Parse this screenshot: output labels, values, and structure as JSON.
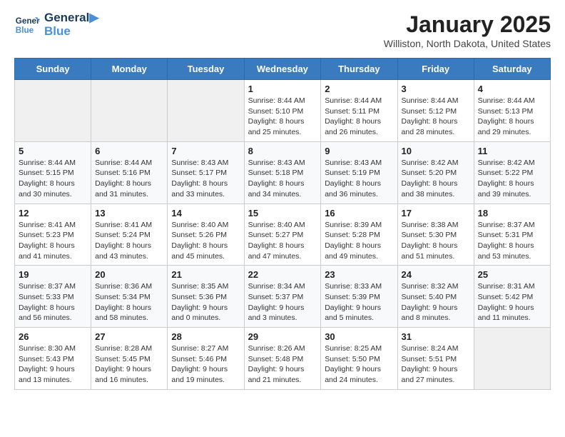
{
  "header": {
    "logo_line1": "General",
    "logo_line2": "Blue",
    "month": "January 2025",
    "location": "Williston, North Dakota, United States"
  },
  "weekdays": [
    "Sunday",
    "Monday",
    "Tuesday",
    "Wednesday",
    "Thursday",
    "Friday",
    "Saturday"
  ],
  "weeks": [
    [
      {
        "day": "",
        "sunrise": "",
        "sunset": "",
        "daylight": ""
      },
      {
        "day": "",
        "sunrise": "",
        "sunset": "",
        "daylight": ""
      },
      {
        "day": "",
        "sunrise": "",
        "sunset": "",
        "daylight": ""
      },
      {
        "day": "1",
        "sunrise": "Sunrise: 8:44 AM",
        "sunset": "Sunset: 5:10 PM",
        "daylight": "Daylight: 8 hours and 25 minutes."
      },
      {
        "day": "2",
        "sunrise": "Sunrise: 8:44 AM",
        "sunset": "Sunset: 5:11 PM",
        "daylight": "Daylight: 8 hours and 26 minutes."
      },
      {
        "day": "3",
        "sunrise": "Sunrise: 8:44 AM",
        "sunset": "Sunset: 5:12 PM",
        "daylight": "Daylight: 8 hours and 28 minutes."
      },
      {
        "day": "4",
        "sunrise": "Sunrise: 8:44 AM",
        "sunset": "Sunset: 5:13 PM",
        "daylight": "Daylight: 8 hours and 29 minutes."
      }
    ],
    [
      {
        "day": "5",
        "sunrise": "Sunrise: 8:44 AM",
        "sunset": "Sunset: 5:15 PM",
        "daylight": "Daylight: 8 hours and 30 minutes."
      },
      {
        "day": "6",
        "sunrise": "Sunrise: 8:44 AM",
        "sunset": "Sunset: 5:16 PM",
        "daylight": "Daylight: 8 hours and 31 minutes."
      },
      {
        "day": "7",
        "sunrise": "Sunrise: 8:43 AM",
        "sunset": "Sunset: 5:17 PM",
        "daylight": "Daylight: 8 hours and 33 minutes."
      },
      {
        "day": "8",
        "sunrise": "Sunrise: 8:43 AM",
        "sunset": "Sunset: 5:18 PM",
        "daylight": "Daylight: 8 hours and 34 minutes."
      },
      {
        "day": "9",
        "sunrise": "Sunrise: 8:43 AM",
        "sunset": "Sunset: 5:19 PM",
        "daylight": "Daylight: 8 hours and 36 minutes."
      },
      {
        "day": "10",
        "sunrise": "Sunrise: 8:42 AM",
        "sunset": "Sunset: 5:20 PM",
        "daylight": "Daylight: 8 hours and 38 minutes."
      },
      {
        "day": "11",
        "sunrise": "Sunrise: 8:42 AM",
        "sunset": "Sunset: 5:22 PM",
        "daylight": "Daylight: 8 hours and 39 minutes."
      }
    ],
    [
      {
        "day": "12",
        "sunrise": "Sunrise: 8:41 AM",
        "sunset": "Sunset: 5:23 PM",
        "daylight": "Daylight: 8 hours and 41 minutes."
      },
      {
        "day": "13",
        "sunrise": "Sunrise: 8:41 AM",
        "sunset": "Sunset: 5:24 PM",
        "daylight": "Daylight: 8 hours and 43 minutes."
      },
      {
        "day": "14",
        "sunrise": "Sunrise: 8:40 AM",
        "sunset": "Sunset: 5:26 PM",
        "daylight": "Daylight: 8 hours and 45 minutes."
      },
      {
        "day": "15",
        "sunrise": "Sunrise: 8:40 AM",
        "sunset": "Sunset: 5:27 PM",
        "daylight": "Daylight: 8 hours and 47 minutes."
      },
      {
        "day": "16",
        "sunrise": "Sunrise: 8:39 AM",
        "sunset": "Sunset: 5:28 PM",
        "daylight": "Daylight: 8 hours and 49 minutes."
      },
      {
        "day": "17",
        "sunrise": "Sunrise: 8:38 AM",
        "sunset": "Sunset: 5:30 PM",
        "daylight": "Daylight: 8 hours and 51 minutes."
      },
      {
        "day": "18",
        "sunrise": "Sunrise: 8:37 AM",
        "sunset": "Sunset: 5:31 PM",
        "daylight": "Daylight: 8 hours and 53 minutes."
      }
    ],
    [
      {
        "day": "19",
        "sunrise": "Sunrise: 8:37 AM",
        "sunset": "Sunset: 5:33 PM",
        "daylight": "Daylight: 8 hours and 56 minutes."
      },
      {
        "day": "20",
        "sunrise": "Sunrise: 8:36 AM",
        "sunset": "Sunset: 5:34 PM",
        "daylight": "Daylight: 8 hours and 58 minutes."
      },
      {
        "day": "21",
        "sunrise": "Sunrise: 8:35 AM",
        "sunset": "Sunset: 5:36 PM",
        "daylight": "Daylight: 9 hours and 0 minutes."
      },
      {
        "day": "22",
        "sunrise": "Sunrise: 8:34 AM",
        "sunset": "Sunset: 5:37 PM",
        "daylight": "Daylight: 9 hours and 3 minutes."
      },
      {
        "day": "23",
        "sunrise": "Sunrise: 8:33 AM",
        "sunset": "Sunset: 5:39 PM",
        "daylight": "Daylight: 9 hours and 5 minutes."
      },
      {
        "day": "24",
        "sunrise": "Sunrise: 8:32 AM",
        "sunset": "Sunset: 5:40 PM",
        "daylight": "Daylight: 9 hours and 8 minutes."
      },
      {
        "day": "25",
        "sunrise": "Sunrise: 8:31 AM",
        "sunset": "Sunset: 5:42 PM",
        "daylight": "Daylight: 9 hours and 11 minutes."
      }
    ],
    [
      {
        "day": "26",
        "sunrise": "Sunrise: 8:30 AM",
        "sunset": "Sunset: 5:43 PM",
        "daylight": "Daylight: 9 hours and 13 minutes."
      },
      {
        "day": "27",
        "sunrise": "Sunrise: 8:28 AM",
        "sunset": "Sunset: 5:45 PM",
        "daylight": "Daylight: 9 hours and 16 minutes."
      },
      {
        "day": "28",
        "sunrise": "Sunrise: 8:27 AM",
        "sunset": "Sunset: 5:46 PM",
        "daylight": "Daylight: 9 hours and 19 minutes."
      },
      {
        "day": "29",
        "sunrise": "Sunrise: 8:26 AM",
        "sunset": "Sunset: 5:48 PM",
        "daylight": "Daylight: 9 hours and 21 minutes."
      },
      {
        "day": "30",
        "sunrise": "Sunrise: 8:25 AM",
        "sunset": "Sunset: 5:50 PM",
        "daylight": "Daylight: 9 hours and 24 minutes."
      },
      {
        "day": "31",
        "sunrise": "Sunrise: 8:24 AM",
        "sunset": "Sunset: 5:51 PM",
        "daylight": "Daylight: 9 hours and 27 minutes."
      },
      {
        "day": "",
        "sunrise": "",
        "sunset": "",
        "daylight": ""
      }
    ]
  ]
}
